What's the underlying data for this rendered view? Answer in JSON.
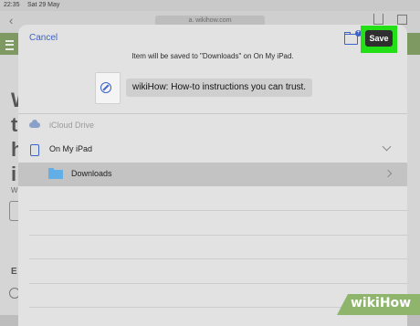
{
  "statusbar": {
    "time": "22:35",
    "date": "Sat 29 May"
  },
  "browser": {
    "address": "a. wikihow.com",
    "page_heading": "W\nt\nh\ni",
    "page_small": "W",
    "page_section": "E"
  },
  "sheet": {
    "cancel_label": "Cancel",
    "save_label": "Save",
    "info_text": "Item will be saved to \"Downloads\" on On My iPad.",
    "item_title": "wikiHow: How-to instructions you can trust.",
    "locations": {
      "icloud_label": "iCloud Drive",
      "ipad_label": "On My iPad",
      "downloads_label": "Downloads"
    }
  },
  "watermark": {
    "text": "wikiHow"
  },
  "colors": {
    "accent": "#3b63c9",
    "highlight": "#22e015",
    "folder": "#62aee6",
    "site_green": "#7e9a62"
  },
  "icons": [
    "back-chevron-icon",
    "share-icon",
    "tabs-icon",
    "menu-icon",
    "new-folder-icon",
    "compass-icon",
    "cloud-icon",
    "ipad-icon",
    "folder-icon",
    "chevron-down-icon",
    "chevron-right-icon"
  ]
}
